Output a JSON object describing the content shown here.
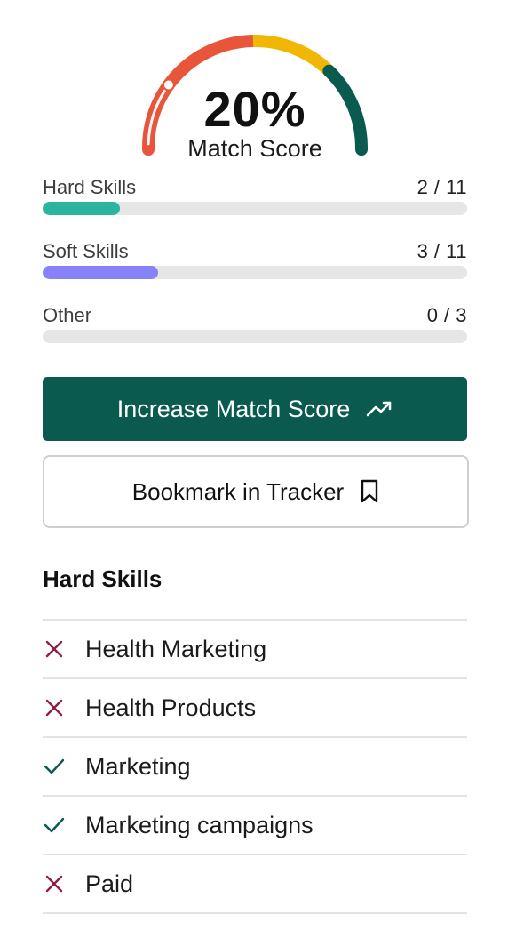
{
  "gauge": {
    "percent_text": "20%",
    "percent_value": 20,
    "label": "Match Score",
    "colors": {
      "low": "#e8553a",
      "mid": "#f2b705",
      "high": "#0a5a50",
      "knob": "#ffffff"
    }
  },
  "skills": [
    {
      "name": "Hard Skills",
      "count": "2 / 11",
      "fraction": 0.182,
      "color": "#2bb59c"
    },
    {
      "name": "Soft Skills",
      "count": "3 / 11",
      "fraction": 0.272,
      "color": "#8682f7"
    },
    {
      "name": "Other",
      "count": "0 / 3",
      "fraction": 0,
      "color": "#2bb59c"
    }
  ],
  "buttons": {
    "increase_label": "Increase Match Score",
    "increase_icon": "trending-up-icon",
    "bookmark_label": "Bookmark in Tracker",
    "bookmark_icon": "bookmark-icon"
  },
  "hard_skills_section": {
    "title": "Hard Skills",
    "items": [
      {
        "label": "Health Marketing",
        "status": "missing"
      },
      {
        "label": "Health Products",
        "status": "missing"
      },
      {
        "label": "Marketing",
        "status": "matched"
      },
      {
        "label": "Marketing campaigns",
        "status": "matched"
      },
      {
        "label": "Paid",
        "status": "missing"
      }
    ],
    "colors": {
      "missing": "#8c1f4a",
      "matched": "#0a5a50"
    }
  }
}
